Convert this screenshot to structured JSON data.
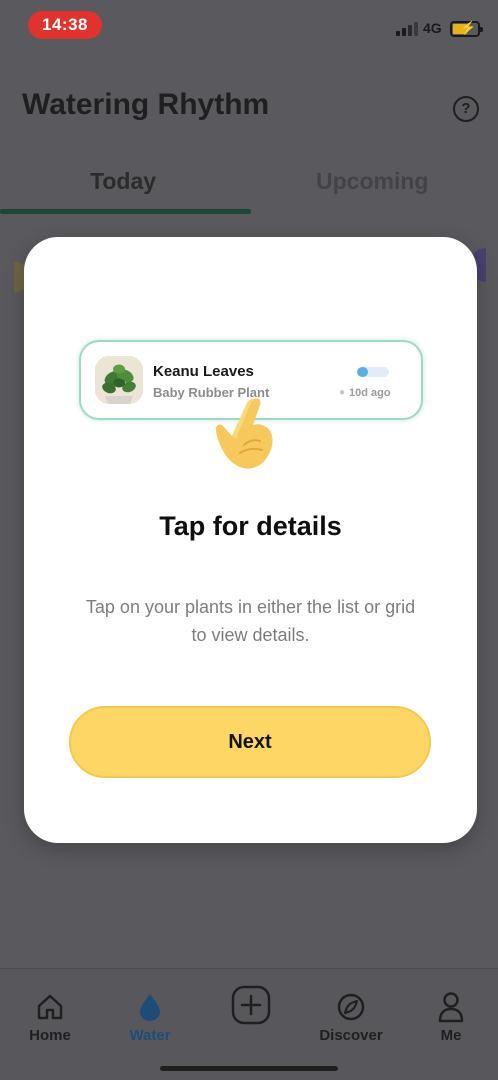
{
  "status_bar": {
    "time": "14:38",
    "network": "4G",
    "time_pill_color": "#e0322e",
    "battery_color": "#e6b31e"
  },
  "header": {
    "title": "Watering Rhythm",
    "help_icon": "help-circle-icon"
  },
  "tabs": [
    {
      "label": "Today",
      "active": true
    },
    {
      "label": "Upcoming",
      "active": false
    }
  ],
  "onboarding_modal": {
    "plant_card": {
      "name": "Keanu Leaves",
      "species": "Baby Rubber Plant",
      "last_watered": "10d ago",
      "water_level": 0.35,
      "accent_color": "#9fd9c3"
    },
    "title": "Tap for details",
    "description": "Tap on your plants in either the list or grid to view details.",
    "next_label": "Next",
    "next_button_color": "#fdd665"
  },
  "bottom_nav": {
    "items": [
      {
        "label": "Home",
        "icon": "home-icon",
        "active": false
      },
      {
        "label": "Water",
        "icon": "water-drop-icon",
        "active": true
      },
      {
        "label": "",
        "icon": "plus-square-icon",
        "active": false
      },
      {
        "label": "Discover",
        "icon": "compass-icon",
        "active": false
      },
      {
        "label": "Me",
        "icon": "person-icon",
        "active": false
      }
    ],
    "active_color": "#1e4c78"
  }
}
